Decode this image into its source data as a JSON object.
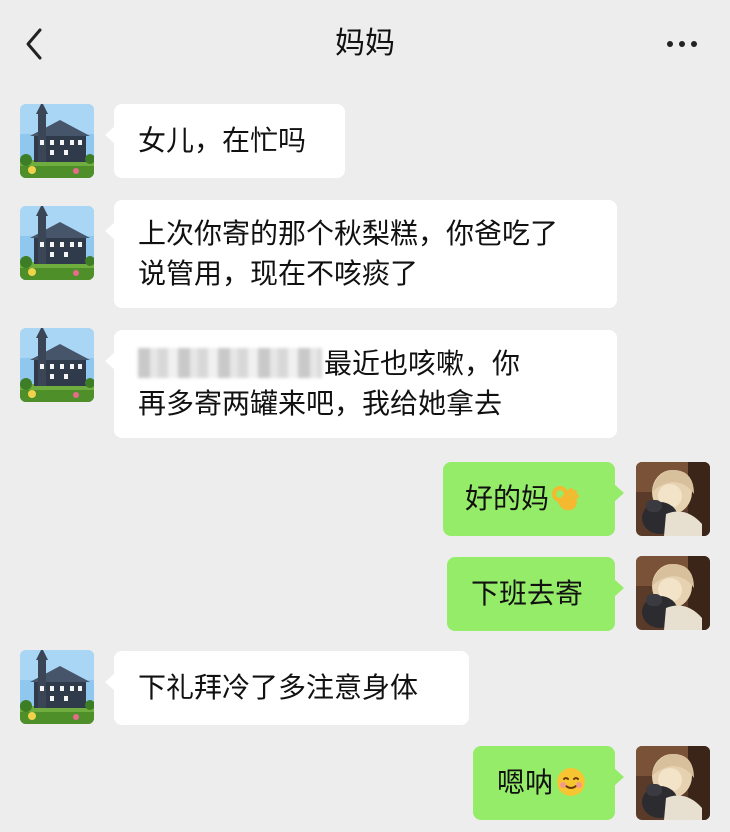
{
  "header": {
    "title": "妈妈"
  },
  "messages": [
    {
      "side": "in",
      "lines": [
        "女儿，在忙吗"
      ]
    },
    {
      "side": "in",
      "lines": [
        "上次你寄的那个秋梨糕，你爸吃了",
        "说管用，现在不咳痰了"
      ]
    },
    {
      "side": "in",
      "lines": [
        "最近也咳嗽，你",
        "再多寄两罐来吧，我给她拿去"
      ]
    },
    {
      "side": "out",
      "text": "好的妈",
      "emoji": "ok-hand-emoji"
    },
    {
      "side": "out",
      "text": "下班去寄"
    },
    {
      "side": "in",
      "lines": [
        "下礼拜冷了多注意身体"
      ]
    },
    {
      "side": "out",
      "text": "嗯呐",
      "emoji": "smiling-face-emoji"
    }
  ],
  "colors": {
    "background": "#ededed",
    "incoming_bubble": "#ffffff",
    "outgoing_bubble": "#95ec69"
  }
}
